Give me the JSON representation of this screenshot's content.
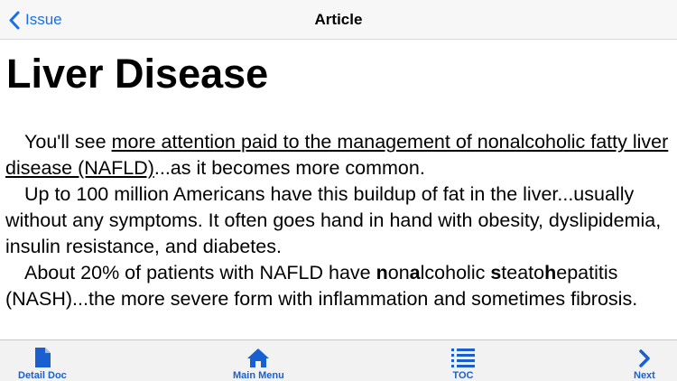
{
  "nav": {
    "back_label": "Issue",
    "title": "Article"
  },
  "article": {
    "title": "Liver Disease",
    "p1_link": "more attention paid to the management of nonalcoholic fatty liver disease (NAFLD)",
    "p1_before": "You'll see ",
    "p1_after": "...as it becomes more common.",
    "p2": "Up to 100 million Americans have this buildup of fat in the liver...usually without any symptoms. It often goes hand in hand with obesity, dyslipidemia, insulin resistance, and diabetes.",
    "p3_a": "About 20% of patients with NAFLD have ",
    "p3_n": "n",
    "p3_o": "on",
    "p3_a2": "a",
    "p3_lcoholic": "lcoholic ",
    "p3_s": "s",
    "p3_teato": "teato",
    "p3_h": "h",
    "p3_rest": "epatitis (NASH)...the more severe form with inflammation and sometimes fibrosis."
  },
  "tabs": [
    {
      "label": "Detail Doc",
      "icon": "document-icon"
    },
    {
      "label": "Main Menu",
      "icon": "home-icon"
    },
    {
      "label": "TOC",
      "icon": "list-icon"
    },
    {
      "label": "Next",
      "icon": "chevron-right-icon"
    }
  ],
  "colors": {
    "accent": "#1a6fe8",
    "tab_accent": "#1a5fd0"
  }
}
